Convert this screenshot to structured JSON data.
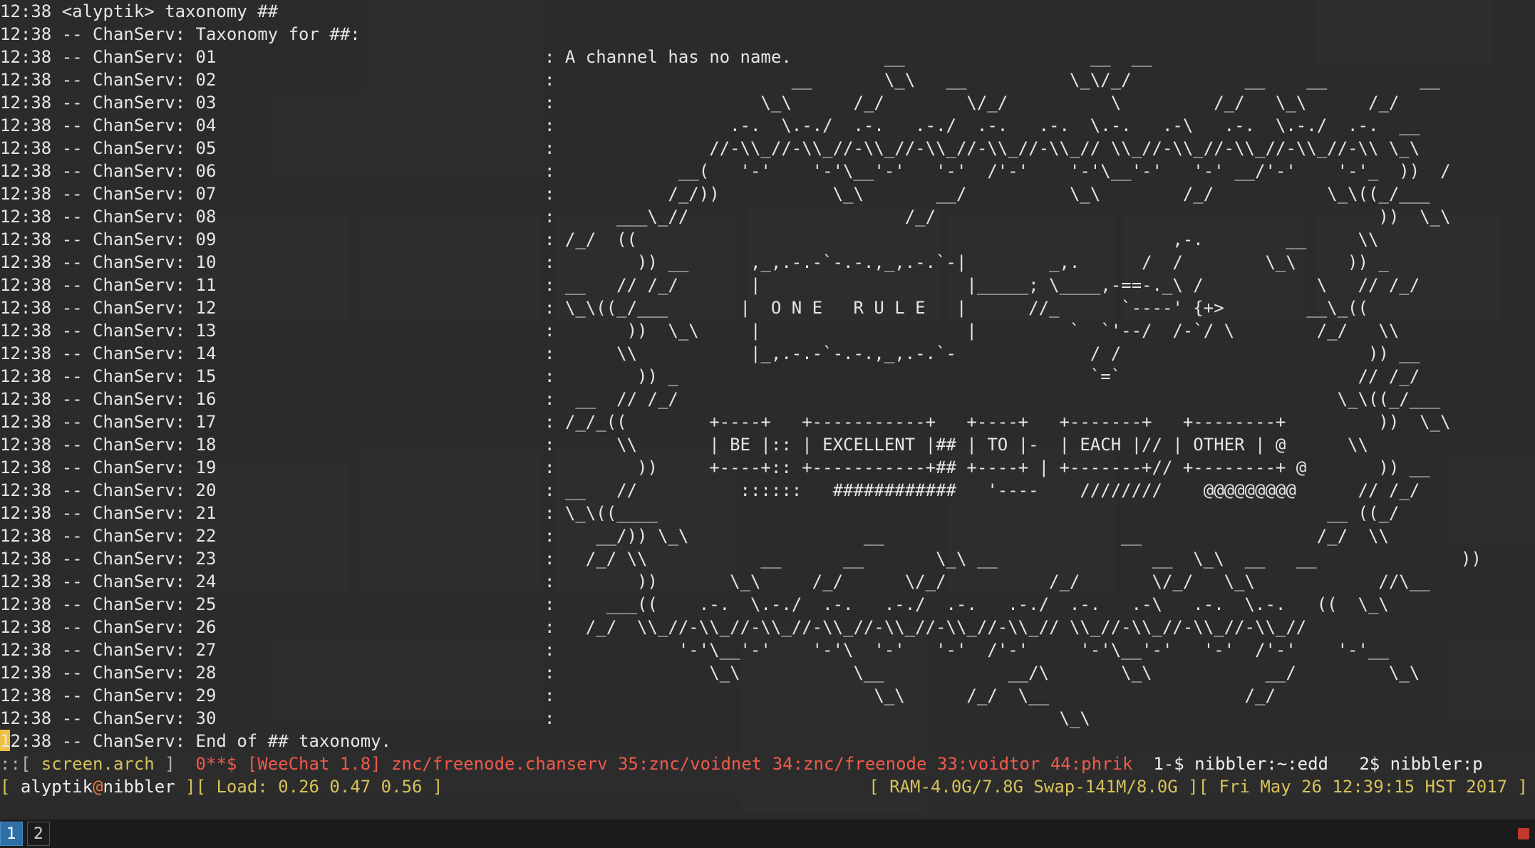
{
  "chat": {
    "header_lines": [
      "12:38 <alyptik> taxonomy ##",
      "12:38 -- ChanServ: Taxonomy for ##:"
    ],
    "lines": [
      {
        "prefix": "12:38 -- ChanServ: 01",
        "msg": ": A channel has no name.         __                  __  __"
      },
      {
        "prefix": "12:38 -- ChanServ: 02",
        "msg": ":                       __       \\_\\   __          \\_\\/_/           __    __         __"
      },
      {
        "prefix": "12:38 -- ChanServ: 03",
        "msg": ":                    \\_\\      /_/        \\/_/          \\         /_/   \\_\\      /_/"
      },
      {
        "prefix": "12:38 -- ChanServ: 04",
        "msg": ":                 .-.  \\.-./  .-.   .-./  .-.   .-.  \\.-.   .-\\   .-.  \\.-./  .-.  __"
      },
      {
        "prefix": "12:38 -- ChanServ: 05",
        "msg": ":               //-\\\\_//-\\\\_//-\\\\_//-\\\\_//-\\\\_//-\\\\_// \\\\_//-\\\\_//-\\\\_//-\\\\_//-\\\\ \\_\\"
      },
      {
        "prefix": "12:38 -- ChanServ: 06",
        "msg": ":            __(   '-'    '-'\\__'-'   '-'  /'-'    '-'\\__'-'   '-' __/'-'    '-'_  ))  /"
      },
      {
        "prefix": "12:38 -- ChanServ: 07",
        "msg": ":           /_/))           \\_\\       __/          \\_\\        /_/           \\_\\((_/___"
      },
      {
        "prefix": "12:38 -- ChanServ: 08",
        "msg": ":      ___\\_//                     /_/                                           ))  \\_\\"
      },
      {
        "prefix": "12:38 -- ChanServ: 09",
        "msg": ": /_/  ((                                                    ,-.        __     \\\\"
      },
      {
        "prefix": "12:38 -- ChanServ: 10",
        "msg": ":        )) __      ,_,.-.-`-.-.,_,.-.`-|        _,.      /  /        \\_\\     )) _"
      },
      {
        "prefix": "12:38 -- ChanServ: 11",
        "msg": ": __   // /_/       |                    |_____; \\____,-==-._\\ /           \\   // /_/"
      },
      {
        "prefix": "12:38 -- ChanServ: 12",
        "msg": ": \\_\\((_/___       |  O N E   R U L E   |      //_      `----' {+>        __\\_((  "
      },
      {
        "prefix": "12:38 -- ChanServ: 13",
        "msg": ":       ))  \\_\\     |                    |         `  `'--/  /-`/ \\        /_/   \\\\"
      },
      {
        "prefix": "12:38 -- ChanServ: 14",
        "msg": ":      \\\\           |_,.-.-`-.-.,_,.-.`-             / /                        )) __"
      },
      {
        "prefix": "12:38 -- ChanServ: 15",
        "msg": ":        )) _                                        `=`                       // /_/"
      },
      {
        "prefix": "12:38 -- ChanServ: 16",
        "msg": ":  __  // /_/                                                                \\_\\((_/___"
      },
      {
        "prefix": "12:38 -- ChanServ: 17",
        "msg": ": /_/_((        +----+   +-----------+   +----+   +-------+   +--------+         ))  \\_\\"
      },
      {
        "prefix": "12:38 -- ChanServ: 18",
        "msg": ":      \\\\       | BE |:: | EXCELLENT |## | TO |-  | EACH |// | OTHER | @      \\\\"
      },
      {
        "prefix": "12:38 -- ChanServ: 19",
        "msg": ":        ))     +----+:: +-----------+## +----+ | +-------+// +--------+ @       )) __"
      },
      {
        "prefix": "12:38 -- ChanServ: 20",
        "msg": ": __   //          ::::::   ############   '----    ////////    @@@@@@@@@      // /_/"
      },
      {
        "prefix": "12:38 -- ChanServ: 21",
        "msg": ": \\_\\((____                                                                 __ ((_/"
      },
      {
        "prefix": "12:38 -- ChanServ: 22",
        "msg": ":    __/)) \\_\\                 __                       __                 /_/  \\\\"
      },
      {
        "prefix": "12:38 -- ChanServ: 23",
        "msg": ":   /_/ \\\\           __      __       \\_\\ __               __  \\_\\  __   __              ))"
      },
      {
        "prefix": "12:38 -- ChanServ: 24",
        "msg": ":        ))       \\_\\     /_/      \\/_/          /_/       \\/_/   \\_\\            //\\__"
      },
      {
        "prefix": "12:38 -- ChanServ: 25",
        "msg": ":     ___((    .-.  \\.-./  .-.   .-./  .-.   .-./  .-.   .-\\   .-.  \\.-.   ((  \\_\\"
      },
      {
        "prefix": "12:38 -- ChanServ: 26",
        "msg": ":   /_/  \\\\_//-\\\\_//-\\\\_//-\\\\_//-\\\\_//-\\\\_//-\\\\_// \\\\_//-\\\\_//-\\\\_//-\\\\_//"
      },
      {
        "prefix": "12:38 -- ChanServ: 27",
        "msg": ":            '-'\\__'-'    '-'\\  '-'   '-'  /'-'     '-'\\__'-'   '-'  /'-'    '-'__"
      },
      {
        "prefix": "12:38 -- ChanServ: 28",
        "msg": ":               \\_\\           \\__            __/\\       \\_\\           __/         \\_\\"
      },
      {
        "prefix": "12:38 -- ChanServ: 29",
        "msg": ":                               \\_\\      /_/  \\__                   /_/"
      },
      {
        "prefix": "12:38 -- ChanServ: 30",
        "msg": ":                                                 \\_\\"
      }
    ],
    "footer_line": "12:38 -- ChanServ: End of ## taxonomy."
  },
  "status_bar": {
    "open": "::[ ",
    "session": "screen.arch",
    "close": " ]  ",
    "active_window": "0**$ [WeeChat 1.8] znc/freenode.chanserv 35:znc/voidnet 34:znc/freenode 33:voidtor 44:phrik",
    "other_windows": "  1-$ nibbler:~:edd   2$ nibbler:p"
  },
  "info_bar": {
    "open": "[ ",
    "user": "alyptik",
    "at": "@",
    "host": "nibbler",
    "sep": " ][ ",
    "load_label": "Load: ",
    "load_values": "0.26 0.47 0.56",
    "load_close": " ]",
    "mem_open": "[ ",
    "mem": "RAM-4.0G/7.8G Swap-141M/8.0G",
    "mem_sep": " ][ ",
    "datetime": "Fri May 26 12:39:15 HST 2017",
    "close": " ]"
  },
  "taskbar": {
    "workspaces": [
      "1",
      "2"
    ],
    "active_workspace": "1"
  }
}
